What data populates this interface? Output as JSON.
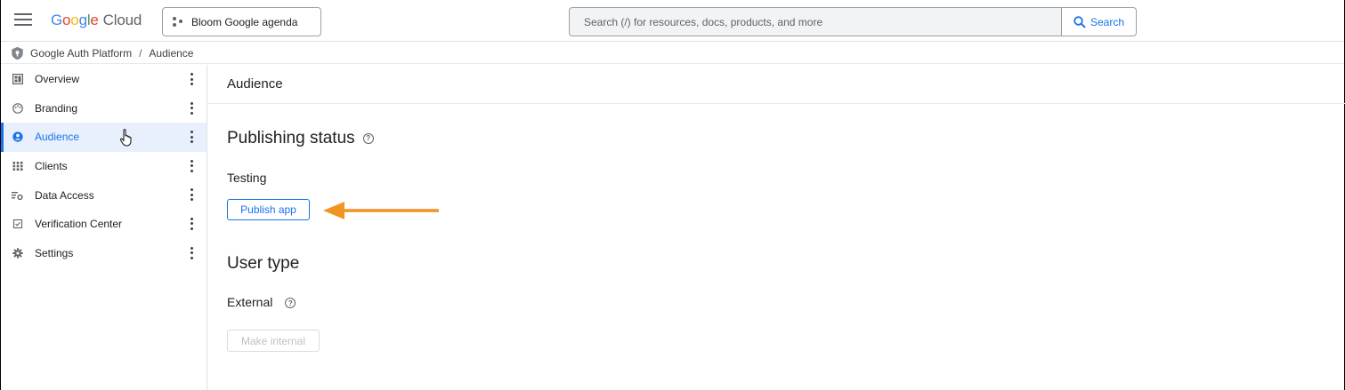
{
  "topbar": {
    "logo_google": [
      "G",
      "o",
      "o",
      "g",
      "l",
      "e"
    ],
    "logo_cloud": "Cloud",
    "project_name": "Bloom Google agenda",
    "search_placeholder": "Search (/) for resources, docs, products, and more",
    "search_button": "Search"
  },
  "breadcrumb": {
    "items": [
      "Google Auth Platform",
      "Audience"
    ],
    "separator": "/"
  },
  "sidebar": {
    "items": [
      {
        "label": "Overview",
        "icon": "dashboard-icon",
        "active": false
      },
      {
        "label": "Branding",
        "icon": "palette-icon",
        "active": false
      },
      {
        "label": "Audience",
        "icon": "person-icon",
        "active": true
      },
      {
        "label": "Clients",
        "icon": "grid-icon",
        "active": false
      },
      {
        "label": "Data Access",
        "icon": "data-access-icon",
        "active": false
      },
      {
        "label": "Verification Center",
        "icon": "checkbox-icon",
        "active": false
      },
      {
        "label": "Settings",
        "icon": "gear-icon",
        "active": false
      }
    ]
  },
  "main": {
    "header": "Audience",
    "publishing": {
      "title": "Publishing status",
      "status": "Testing",
      "button": "Publish app"
    },
    "user_type": {
      "title": "User type",
      "value": "External",
      "button": "Make internal"
    }
  },
  "colors": {
    "accent": "#1a73e8",
    "active_bg": "#e8f0fe",
    "arrow": "#f29423"
  }
}
